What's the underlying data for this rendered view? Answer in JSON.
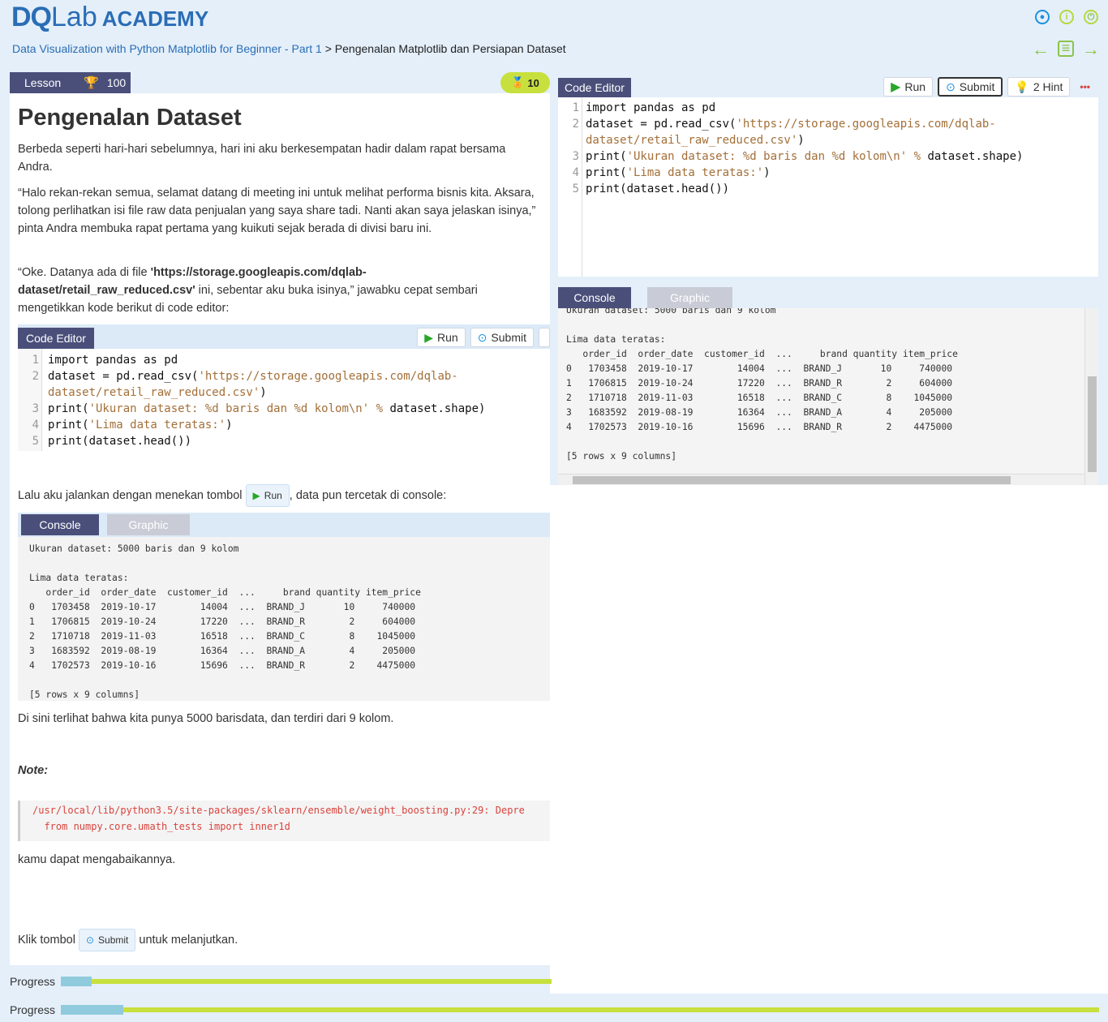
{
  "header": {
    "logo_dq": "DQ",
    "logo_lab": "Lab",
    "logo_academy": "ACADEMY"
  },
  "breadcrumb": {
    "course": "Data Visualization with Python Matplotlib for Beginner - Part 1",
    "sep": ">",
    "chapter": "Pengenalan Matplotlib dan Persiapan Dataset"
  },
  "lesson": {
    "tab": "Lesson",
    "points": "100",
    "xp": "10",
    "title": "Pengenalan Dataset",
    "p1": "Berbeda seperti hari-hari sebelumnya, hari ini aku berkesempatan hadir dalam rapat bersama Andra.",
    "p2": "“Halo rekan-rekan semua, selamat datang di meeting ini untuk melihat performa bisnis kita. Aksara, tolong perlihatkan isi file raw data penjualan yang saya share tadi. Nanti akan saya jelaskan isinya,” pinta Andra membuka rapat pertama yang kuikuti sejak berada di divisi baru ini.",
    "p3a": "“Oke. Datanya ada di file ",
    "p3b": "'https://storage.googleapis.com/dqlab-dataset/retail_raw_reduced.csv'",
    "p3c": " ini, sebentar aku buka isinya,” jawabku cepat sembari mengetikkan kode berikut di code editor:",
    "p4a": "Lalu aku jalankan dengan menekan tombol ",
    "p4b": ", data pun tercetak di console:",
    "p5": "Di sini terlihat bahwa kita punya 5000 barisdata, dan terdiri dari 9 kolom.",
    "note": "Note:",
    "err1": "/usr/local/lib/python3.5/site-packages/sklearn/ensemble/weight_boosting.py:29: Depre",
    "err2": "  from numpy.core.umath_tests import inner1d",
    "p6": "kamu dapat mengabaikannya.",
    "p7a": "Klik tombol ",
    "p7b": " untuk melanjutkan."
  },
  "editor": {
    "tab": "Code Editor",
    "run": "Run",
    "submit": "Submit",
    "hint": "2 Hint",
    "more": "•••"
  },
  "code": {
    "n1": "1",
    "n2": "2",
    "n3": "3",
    "n4": "4",
    "n5": "5",
    "l1": "import pandas as pd",
    "l2a": "dataset = pd.read_csv(",
    "l2b": "'https://storage.googleapis.com/dqlab-",
    "l2c": "dataset/retail_raw_reduced.csv'",
    "l2d": ")",
    "l3a": "print(",
    "l3b": "'Ukuran dataset: %d baris dan %d kolom\\n'",
    "l3c": " % ",
    "l3d": "dataset.shape)",
    "l4a": "print(",
    "l4b": "'Lima data teratas:'",
    "l4c": ")",
    "l5": "print(dataset.head())"
  },
  "console": {
    "tab_console": "Console",
    "tab_graphic": "Graphic",
    "output": "Ukuran dataset: 5000 baris dan 9 kolom\n\nLima data teratas:\n   order_id  order_date  customer_id  ...     brand quantity item_price\n0   1703458  2019-10-17        14004  ...  BRAND_J       10     740000\n1   1706815  2019-10-24        17220  ...  BRAND_R        2     604000\n2   1710718  2019-11-03        16518  ...  BRAND_C        8    1045000\n3   1683592  2019-08-19        16364  ...  BRAND_A        4     205000\n4   1702573  2019-10-16        15696  ...  BRAND_R        2    4475000\n\n[5 rows x 9 columns]"
  },
  "progress": {
    "label": "Progress",
    "value_fraction": 0.06
  }
}
